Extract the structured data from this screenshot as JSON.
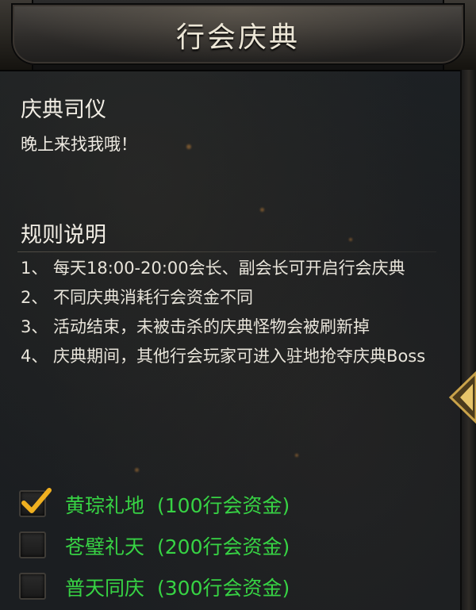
{
  "header": {
    "title": "行会庆典"
  },
  "host": {
    "title": "庆典司仪",
    "message": "晚上来找我哦！"
  },
  "rules": {
    "title": "规则说明",
    "items": [
      "1、 每天18:00-20:00会长、副会长可开启行会庆典",
      "2、 不同庆典消耗行会资金不同",
      "3、 活动结束，未被击杀的庆典怪物会被刷新掉",
      "4、 庆典期间，其他行会玩家可进入驻地抢夺庆典Boss"
    ]
  },
  "options": [
    {
      "name": "黄琮礼地",
      "cost": "(100行会资金)",
      "checked": true
    },
    {
      "name": "苍璧礼天",
      "cost": "(200行会资金)",
      "checked": false
    },
    {
      "name": "普天同庆",
      "cost": "(300行会资金)",
      "checked": false
    }
  ],
  "colors": {
    "option_text": "#37d344",
    "check_mark": "#f0b020",
    "title_text": "#ece6d6"
  },
  "icons": {
    "check": "check-icon",
    "collapse": "chevron-left-icon"
  }
}
